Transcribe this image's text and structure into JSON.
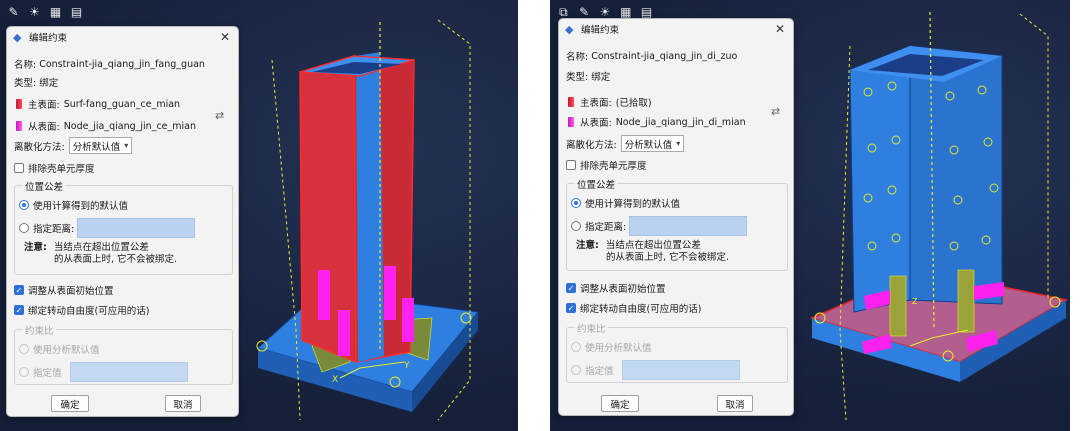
{
  "left": {
    "dialog": {
      "title": "编辑约束",
      "name_label": "名称:",
      "name_value": "Constraint-jia_qiang_jin_fang_guan",
      "type_label": "类型:",
      "type_value": "绑定",
      "master_label": "主表面:",
      "master_value": "Surf-fang_guan_ce_mian",
      "slave_label": "从表面:",
      "slave_value": "Node_jia_qiang_jin_ce_mian",
      "discretization_label": "离散化方法:",
      "discretization_value": "分析默认值",
      "exclude_shell": "排除壳单元厚度",
      "position_tolerance": "位置公差",
      "use_computed": "使用计算得到的默认值",
      "specify_distance": "指定距离:",
      "note_label": "注意:",
      "note_line1": "当结点在超出位置公差",
      "note_line2": "的从表面上时, 它不会被绑定.",
      "adjust_slave": "调整从表面初始位置",
      "tie_rotational": "绑定转动自由度(可应用的话)",
      "constraint_ratio": "约束比",
      "use_analysis_default": "使用分析默认值",
      "specify_value": "指定值",
      "ok": "确定",
      "cancel": "取消"
    }
  },
  "right": {
    "dialog": {
      "title": "编辑约束",
      "name_label": "名称:",
      "name_value": "Constraint-jia_qiang_jin_di_zuo",
      "type_label": "类型:",
      "type_value": "绑定",
      "master_label": "主表面:",
      "master_value": "(已拾取)",
      "slave_label": "从表面:",
      "slave_value": "Node_jia_qiang_jin_di_mian",
      "discretization_label": "离散化方法:",
      "discretization_value": "分析默认值",
      "exclude_shell": "排除壳单元厚度",
      "position_tolerance": "位置公差",
      "use_computed": "使用计算得到的默认值",
      "specify_distance": "指定距离:",
      "note_label": "注意:",
      "note_line1": "当结点在超出位置公差",
      "note_line2": "的从表面上时, 它不会被绑定.",
      "adjust_slave": "调整从表面初始位置",
      "tie_rotational": "绑定转动自由度(可应用的话)",
      "constraint_ratio": "约束比",
      "use_analysis_default": "使用分析默认值",
      "specify_value": "指定值",
      "ok": "确定",
      "cancel": "取消"
    }
  },
  "viewport": {
    "axis_x": "X",
    "axis_y": "Y",
    "axis_z": "Z"
  },
  "colors": {
    "viewport_bg": "#151f39",
    "model_blue": "#2f7fe0",
    "master_surface_red": "#e0262f",
    "slave_surface_magenta": "#ff21f0",
    "mesh_yellow": "#e9ec2a",
    "accent_blue": "#2f6fd8"
  }
}
